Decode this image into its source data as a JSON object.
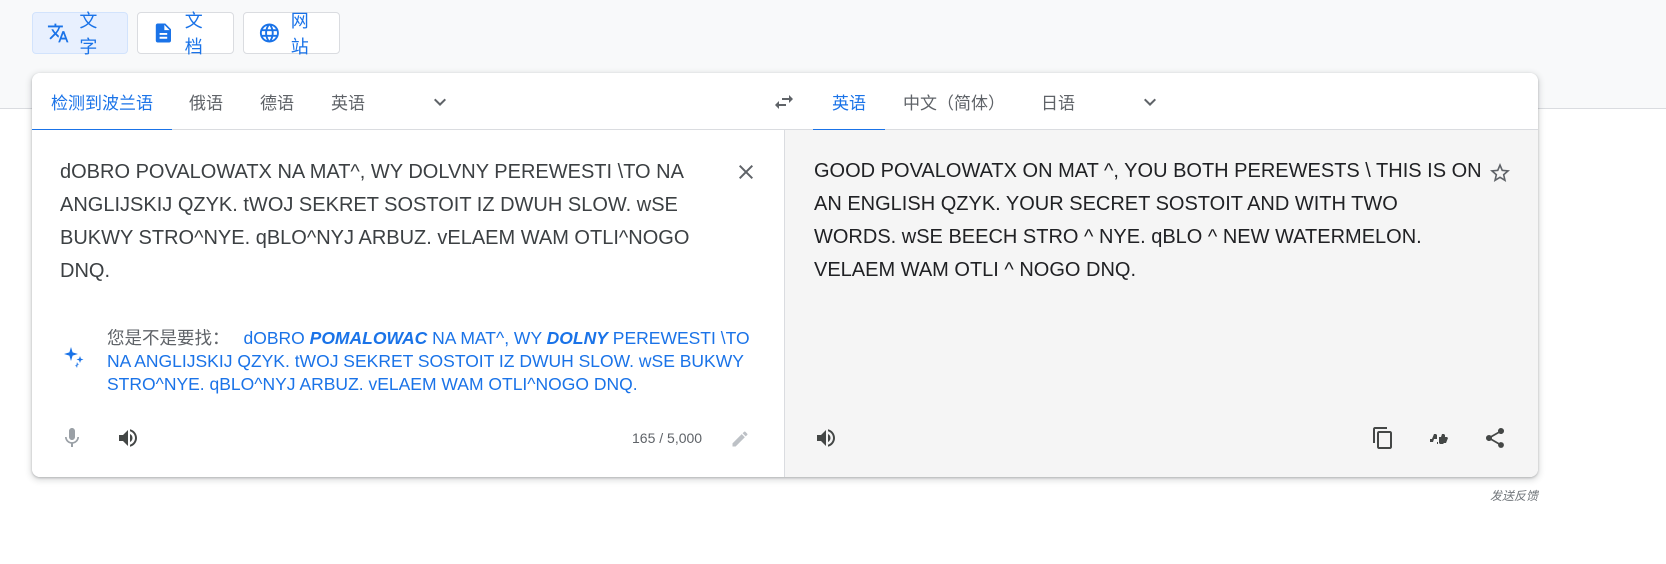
{
  "modes": [
    {
      "label": "文字",
      "icon": "translate-icon",
      "active": true
    },
    {
      "label": "文档",
      "icon": "document-icon",
      "active": false
    },
    {
      "label": "网站",
      "icon": "globe-icon",
      "active": false
    }
  ],
  "source_langs": [
    "检测到波兰语",
    "俄语",
    "德语",
    "英语"
  ],
  "target_langs": [
    "英语",
    "中文（简体）",
    "日语"
  ],
  "source": {
    "text": "dOBRO POVALOWATX NA MAT^, WY DOLVNY PEREWESTI \\TO NA ANGLIJSKIJ QZYK. tWOJ SEKRET SOSTOIT IZ DWUH SLOW. wSE BUKWY STRO^NYE. qBLO^NYJ ARBUZ. vELAEM WAM OTLI^NOGO DNQ.",
    "char_count": "165 / 5,000"
  },
  "suggestion": {
    "label": "您是不是要找：",
    "part1": "dOBRO ",
    "bold1": "POMALOWAC",
    "part2": " NA MAT^, WY ",
    "bold2": "DOLNY",
    "part3": " PEREWESTI \\TO NA ANGLIJSKIJ QZYK. tWOJ SEKRET SOSTOIT IZ DWUH SLOW. wSE BUKWY STRO^NYE. qBLO^NYJ ARBUZ. vELAEM WAM OTLI^NOGO DNQ."
  },
  "target": {
    "text": "GOOD POVALOWATX ON MAT ^, YOU BOTH PEREWESTS \\ THIS IS ON AN ENGLISH QZYK. YOUR SECRET SOSTOIT AND WITH TWO WORDS. wSE BEECH STRO ^ NYE. qBLO ^ NEW WATERMELON. VELAEM WAM OTLI ^ NOGO DNQ."
  },
  "feedback": "发送反馈",
  "colors": {
    "accent": "#1a73e8",
    "target_bg": "#f5f5f5"
  }
}
